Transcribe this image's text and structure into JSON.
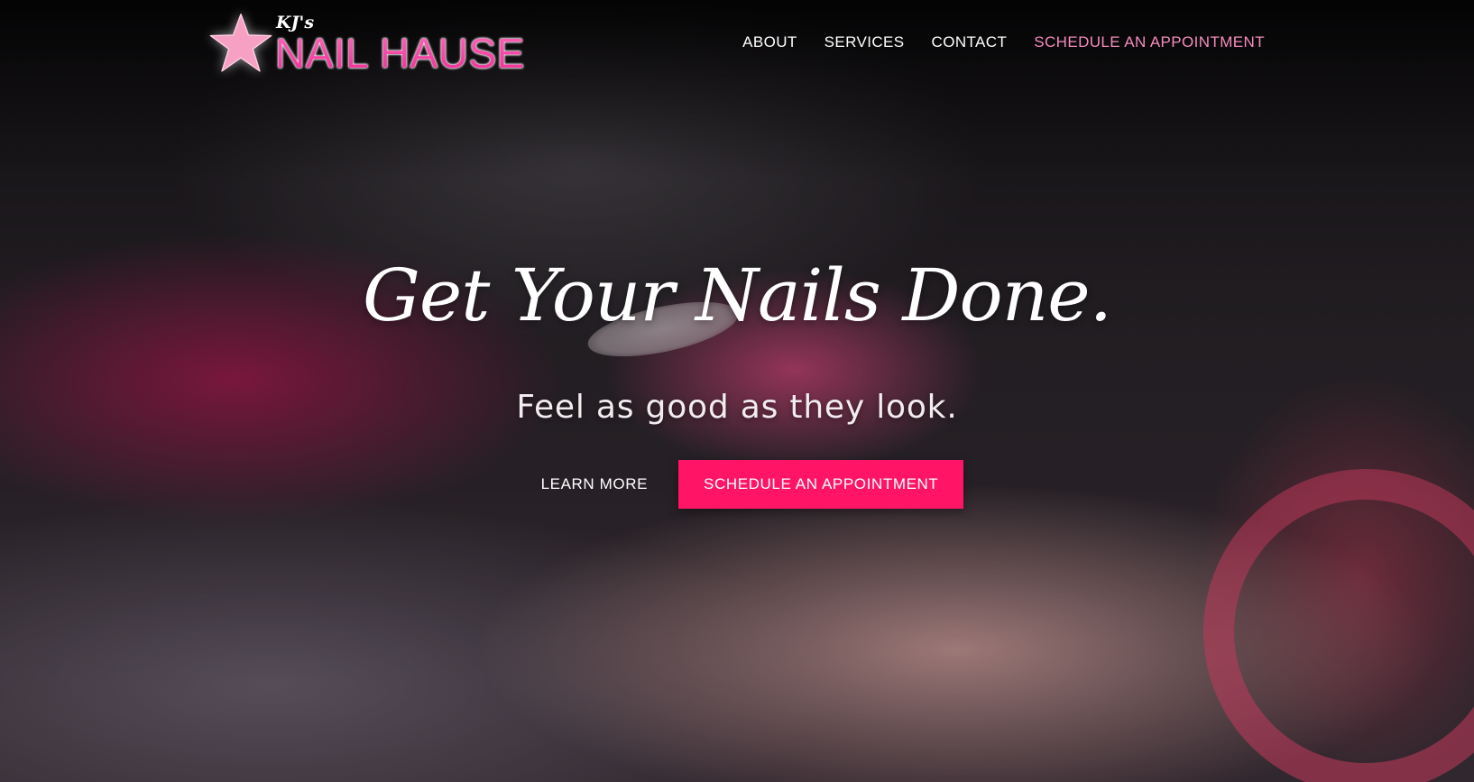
{
  "colors": {
    "brand_pink": "#ff3fa6",
    "nav_accent": "#f58bbd",
    "cta_background": "#ff1466",
    "text_white": "#ffffff"
  },
  "logo": {
    "small_text": "KJ's",
    "main_text": "NAIL HAUSE",
    "icon": "star-icon"
  },
  "nav": {
    "items": [
      {
        "label": "ABOUT"
      },
      {
        "label": "SERVICES"
      },
      {
        "label": "CONTACT"
      },
      {
        "label": "SCHEDULE AN APPOINTMENT"
      }
    ]
  },
  "hero": {
    "headline": "Get Your Nails Done.",
    "subheadline": "Feel as good as they look.",
    "learn_more_label": "LEARN MORE",
    "schedule_label": "SCHEDULE AN APPOINTMENT"
  }
}
